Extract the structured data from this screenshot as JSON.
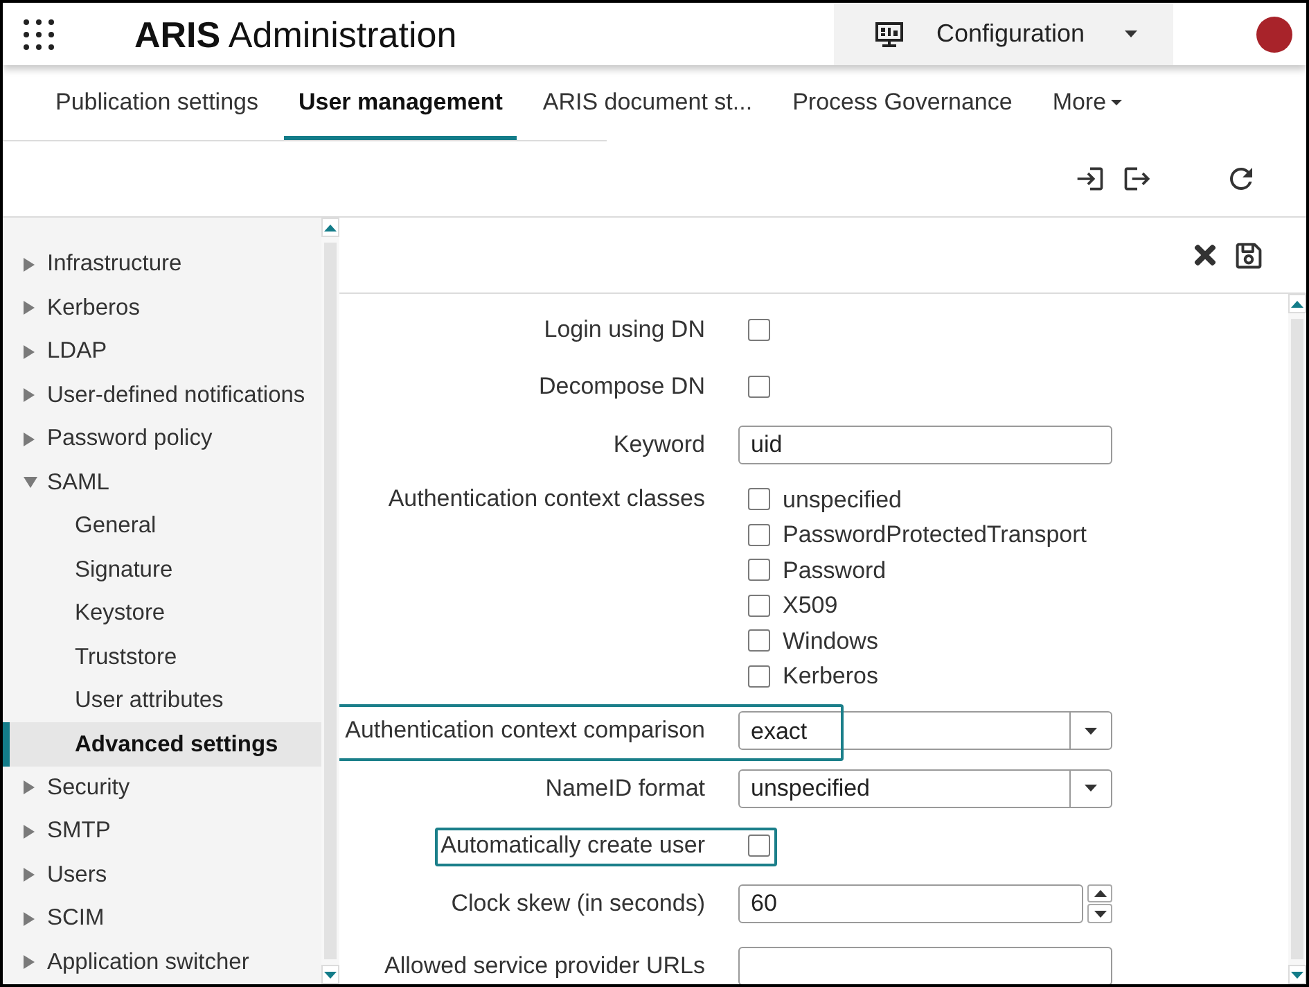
{
  "header": {
    "title": "**ARIS** Administration",
    "context": {
      "label": "Configuration"
    }
  },
  "tabs": [
    {
      "label": "Publication settings",
      "kind": "tab",
      "selected": false
    },
    {
      "label": "User management",
      "kind": "tab",
      "selected": true
    },
    {
      "label": "ARIS document st...",
      "kind": "tab",
      "selected": false
    },
    {
      "label": "Process Governance",
      "kind": "tab",
      "selected": false
    },
    {
      "label": "More",
      "kind": "menu",
      "selected": false
    }
  ],
  "sidebar": {
    "items": [
      {
        "label": "Infrastructure",
        "expanded": false,
        "selected": false
      },
      {
        "label": "Kerberos",
        "expanded": false,
        "selected": false
      },
      {
        "label": "LDAP",
        "expanded": false,
        "selected": false
      },
      {
        "label": "User-defined notifications",
        "expanded": false,
        "selected": false
      },
      {
        "label": "Password policy",
        "expanded": false,
        "selected": false
      },
      {
        "label": "SAML",
        "expanded": true,
        "selected": false,
        "children": [
          {
            "label": "General",
            "selected": false
          },
          {
            "label": "Signature",
            "selected": false
          },
          {
            "label": "Keystore",
            "selected": false
          },
          {
            "label": "Truststore",
            "selected": false
          },
          {
            "label": "User attributes",
            "selected": false
          },
          {
            "label": "Advanced settings",
            "selected": true
          }
        ]
      },
      {
        "label": "Security",
        "expanded": false,
        "selected": false
      },
      {
        "label": "SMTP",
        "expanded": false,
        "selected": false
      },
      {
        "label": "Users",
        "expanded": false,
        "selected": false
      },
      {
        "label": "SCIM",
        "expanded": false,
        "selected": false
      },
      {
        "label": "Application switcher",
        "expanded": false,
        "selected": false
      }
    ]
  },
  "form": {
    "fields": [
      {
        "kind": "checkbox",
        "label": "Login using DN",
        "checked": false,
        "highlighted": false
      },
      {
        "kind": "checkbox",
        "label": "Decompose DN",
        "checked": false,
        "highlighted": false
      },
      {
        "kind": "text",
        "label": "Keyword",
        "value": "uid",
        "highlighted": false
      },
      {
        "kind": "checklist",
        "label": "Authentication context classes",
        "highlighted": false,
        "options": [
          {
            "label": "unspecified",
            "checked": false
          },
          {
            "label": "PasswordProtectedTransport",
            "checked": false
          },
          {
            "label": "Password",
            "checked": false
          },
          {
            "label": "X509",
            "checked": false
          },
          {
            "label": "Windows",
            "checked": false
          },
          {
            "label": "Kerberos",
            "checked": false
          }
        ]
      },
      {
        "kind": "select",
        "label": "Authentication context comparison",
        "value": "exact",
        "highlighted": true
      },
      {
        "kind": "select",
        "label": "NameID format",
        "value": "unspecified",
        "highlighted": false
      },
      {
        "kind": "checkbox",
        "label": "Automatically create user",
        "checked": false,
        "highlighted": true
      },
      {
        "kind": "number",
        "label": "Clock skew (in seconds)",
        "value": "60",
        "highlighted": false
      },
      {
        "kind": "text",
        "label": "Allowed service provider URLs",
        "highlighted": false
      }
    ]
  }
}
